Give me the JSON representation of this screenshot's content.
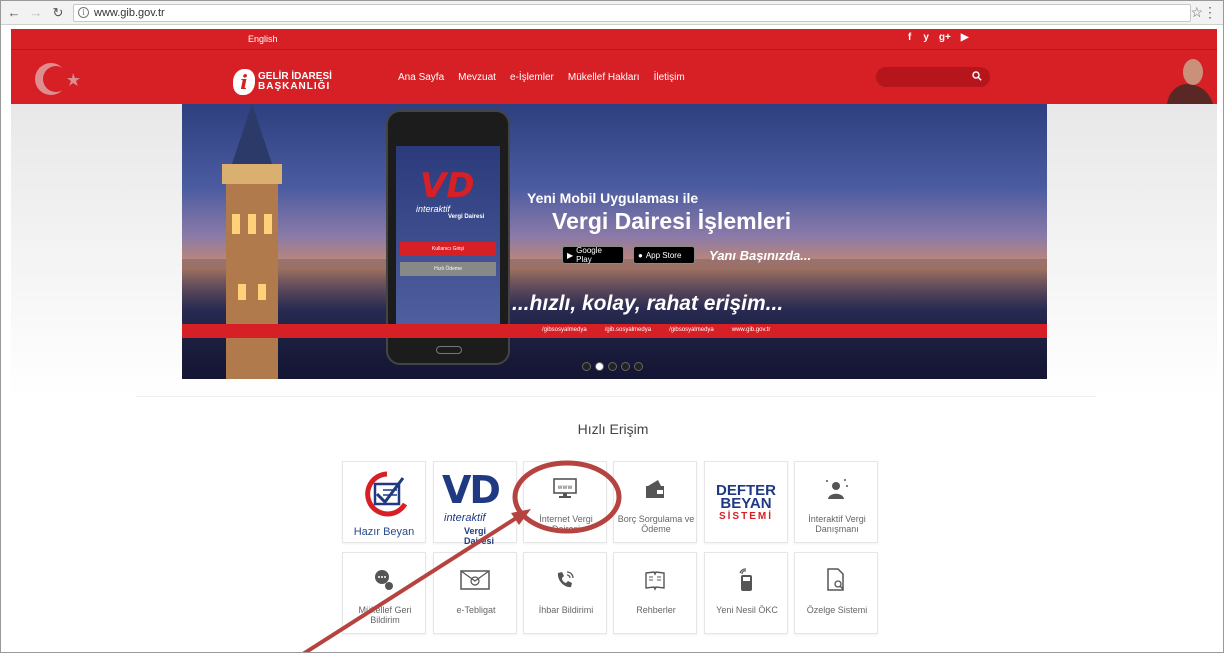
{
  "browser": {
    "back_icon": "back-arrow-icon",
    "forward_icon": "forward-arrow-icon",
    "reload_icon": "reload-icon",
    "url": "www.gib.gov.tr"
  },
  "header": {
    "lang": "English",
    "social": [
      "f",
      " y",
      "g+",
      "▶"
    ],
    "logo_line1": "GELİR İDARESİ",
    "logo_line2": "BAŞKANLIĞI",
    "logo_mark": "i",
    "nav": [
      "Ana Sayfa",
      "Mevzuat",
      "e-İşlemler",
      "Mükellef Hakları",
      "İletişim"
    ],
    "search_placeholder": "",
    "colors": {
      "brand_red": "#d71f26"
    }
  },
  "hero": {
    "vd": "VD",
    "vd_sub1": "interaktif",
    "vd_sub2": "Vergi Dairesi",
    "btn_login": "Kullanıcı Girişi",
    "btn_pay": "Hızlı Ödeme",
    "line1": "Yeni Mobil Uygulaması ile",
    "line2": "Vergi Dairesi İşlemleri",
    "google_play": "Google Play",
    "app_store": "App Store",
    "line3": "Yanı Başınızda...",
    "line4": "...hızlı, kolay, rahat erişim...",
    "strip": [
      "/gibsosyalmedya",
      "/gib.sosyalmedya",
      "/gibsosyalmedya",
      "www.gib.gov.tr"
    ],
    "active_slide": 2
  },
  "quick_access": {
    "title": "Hızlı Erişim",
    "row1": {
      "hazir_beyan": "Hazır Beyan",
      "ivd_logo": "VD",
      "ivd_sub1": "interaktif",
      "ivd_sub2": "Vergi Dairesi",
      "internet_vergi": "İnternet Vergi Dairesi",
      "borc": "Borç Sorgulama ve Ödeme",
      "defter_l1": "DEFTER",
      "defter_l2": "BEYAN",
      "defter_l3": "SİSTEMİ",
      "danismani": "İnteraktif Vergi Danışmanı"
    },
    "row2": {
      "geri_bildirim": "Mükellef Geri Bildirim",
      "tebligat": "e-Tebligat",
      "ihbar": "İhbar Bildirimi",
      "rehberler": "Rehberler",
      "okc": "Yeni Nesil ÖKC",
      "ozelge": "Özelge Sistemi"
    }
  },
  "annotation": {
    "color": "#b5433f"
  }
}
